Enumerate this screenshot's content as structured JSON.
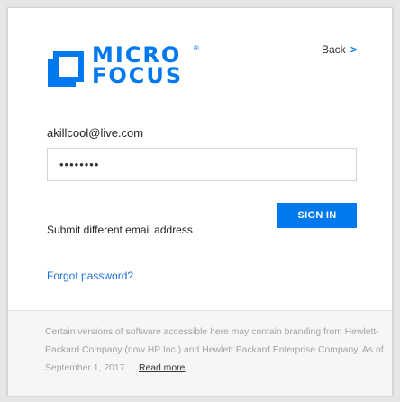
{
  "header": {
    "logo_line1": "MICRO",
    "logo_line2": "FOCUS",
    "logo_mark": "®",
    "back_label": "Back",
    "back_chevron": ">"
  },
  "form": {
    "email": "akillcool@live.com",
    "password_value": "••••••••",
    "signin_label": "SIGN IN",
    "different_email_label": "Submit different email address",
    "forgot_label": "Forgot password?"
  },
  "footer": {
    "notice": "Certain versions of software accessible here may contain branding from Hewlett-Packard Company (now HP Inc.) and Hewlett Packard Enterprise Company. As of September 1, 2017...",
    "read_more_label": "Read more"
  },
  "colors": {
    "brand_blue": "#0079ef",
    "link_blue": "#1a6fd8",
    "footer_text": "#a3a3a3",
    "page_bg": "#e6e6e6"
  },
  "icons": {
    "logo": "micro-focus-logo-icon",
    "back": "chevron-right-icon"
  }
}
